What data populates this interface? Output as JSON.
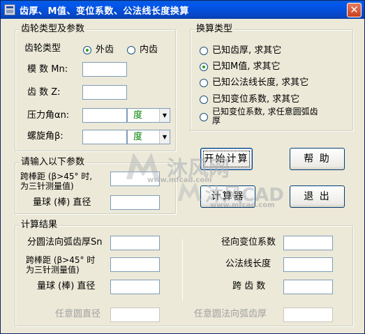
{
  "window": {
    "title": "齿厚、M值、变位系数、公法线长度换算",
    "close_label": "✕"
  },
  "gear_type_group": {
    "title": "齿轮类型及参数",
    "gear_type_label": "齿轮类型",
    "external": "外齿",
    "internal": "内齿",
    "module_label": "模  数 Mn:",
    "teeth_label": "齿  数 Z:",
    "pressure_label": "压力角αn:",
    "helix_label": "螺旋角β:",
    "pressure_unit": "度",
    "helix_unit": "度"
  },
  "conversion_group": {
    "title": "换算类型",
    "opt1": "已知齿厚, 求其它",
    "opt2": "已知M值, 求其它",
    "opt3": "已知公法线长度, 求其它",
    "opt4": "已知变位系数, 求其它",
    "opt5_line1": "已知变位系数, 求任意圆弧齿",
    "opt5_line2": "厚"
  },
  "input_group": {
    "title": "请输入以下参数",
    "span_line1": "跨棒距 (β>45° 时,",
    "span_line2": "为三针测量值)",
    "ball_label": "量球 (棒) 直径"
  },
  "buttons": {
    "start": "开始计算",
    "help": "帮 助",
    "calc": "计算器",
    "exit": "退 出"
  },
  "result_group": {
    "title": "计算结果",
    "arc_thickness": "分圆法向弧齿厚Sn",
    "span_line1": "跨棒距 (β>45° 时",
    "span_line2": "为三针测量值)",
    "ball_label": "量球 (棒) 直径",
    "radial_shift": "径向变位系数",
    "base_tangent": "公法线长度",
    "span_teeth": "跨 齿 数",
    "arb_diameter": "任意圆直径",
    "arb_thickness": "任意圆法向弧齿厚"
  },
  "watermark": {
    "text1": "沐风网",
    "url1": "www.mfcad.com",
    "text2": "沐风CAD",
    "url2": "www.mfcad.com"
  }
}
